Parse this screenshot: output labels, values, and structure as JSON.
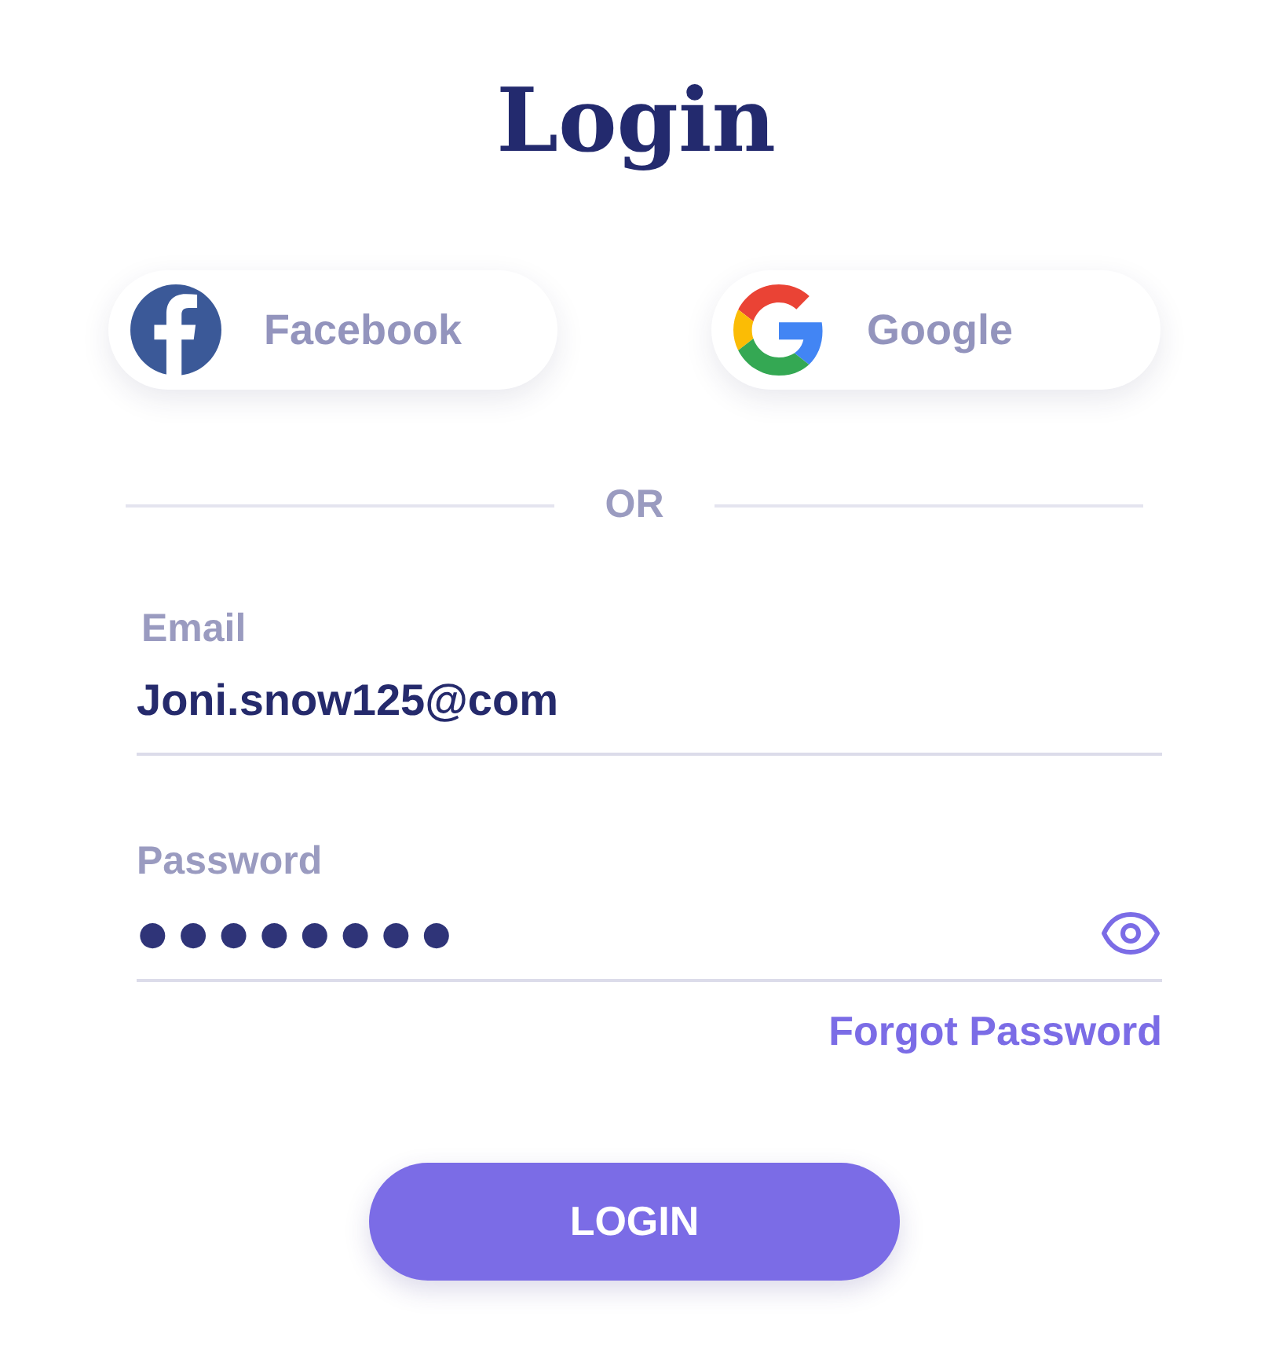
{
  "title": "Login",
  "social_buttons": [
    {
      "kind": "facebook",
      "label": "Facebook"
    },
    {
      "kind": "google",
      "label": "Google"
    }
  ],
  "divider": "OR",
  "fields": [
    {
      "kind": "text",
      "label": "Email",
      "value": "Joni.snow125@com"
    },
    {
      "kind": "password",
      "label": "Password",
      "value": "●●●●●●●●"
    }
  ],
  "forgot_link": "Forgot Password",
  "submit_button": "LOGIN"
}
